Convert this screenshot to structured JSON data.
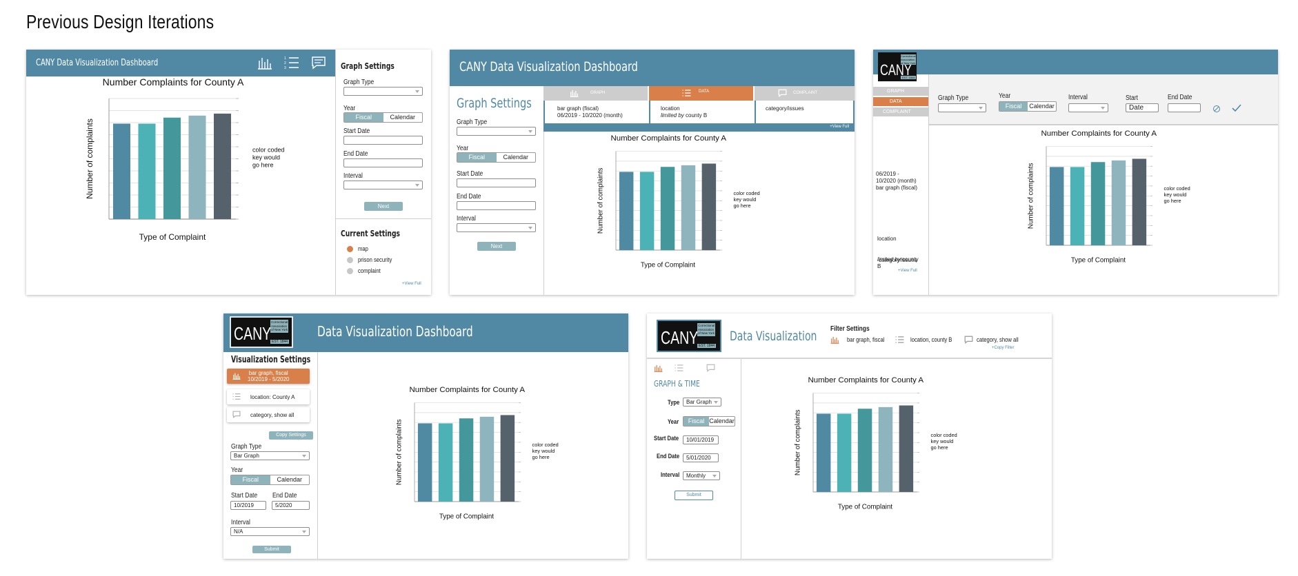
{
  "page_title": "Previous Design Iterations",
  "colors": {
    "header": "#5189a4",
    "accent": "#d9804a",
    "toggle": "#8fb3bb",
    "bars": [
      "#4f89a2",
      "#4cb2b5",
      "#44979b",
      "#8eb5bd",
      "#55626c"
    ]
  },
  "chart": {
    "title": "Number Complaints for County A",
    "xlabel": "Type of Complaint",
    "ylabel": "Number of complaints",
    "legend_note": "color coded\nkey would\ngo here"
  },
  "chart_data": {
    "type": "bar",
    "title": "Number Complaints for County A",
    "xlabel": "Type of Complaint",
    "ylabel": "Number of complaints",
    "values": [
      0.95,
      0.95,
      1.01,
      1.03,
      1.05
    ],
    "ylim": [
      0,
      1.2
    ],
    "grid": true,
    "legend": "color coded key would go here (right)"
  },
  "d1": {
    "title": "CANY Data Visualization Dashboard",
    "icons": [
      "bar-chart-icon",
      "list-icon",
      "comment-icon"
    ],
    "settings_title": "Graph Settings",
    "graph_type": "Graph Type",
    "year": "Year",
    "fiscal": "Fiscal",
    "calendar": "Calendar",
    "start_date": "Start Date",
    "end_date": "End Date",
    "interval": "Interval",
    "next": "Next",
    "current_title": "Current Settings",
    "current_items": [
      "map",
      "prison security",
      "complaint"
    ],
    "view_full": "+View Full"
  },
  "d2": {
    "title": "CANY Data Visualization Dashboard",
    "settings_title": "Graph Settings",
    "graph_type": "Graph Type",
    "year": "Year",
    "fiscal": "Fiscal",
    "calendar": "Calendar",
    "start_date": "Start Date",
    "end_date": "End Date",
    "interval": "Interval",
    "next": "Next",
    "tabs": [
      "GRAPH",
      "DATA",
      "COMPLAINT"
    ],
    "col1": "bar graph (fiscal)\n06/2019 - 10/2020 (month)",
    "col2a": "location",
    "col2b": "limited by",
    "col2c": " county B",
    "col3": "category/issues",
    "view_full": "+View Full"
  },
  "d3": {
    "logo_big": "CANY",
    "logo_org": "Correctional\nAssociation\nof New York",
    "logo_est": "EST. 1844",
    "tabs": [
      "GRAPH",
      "DATA",
      "COMPLAINT"
    ],
    "graph_type": "Graph Type",
    "year": "Year",
    "fiscal": "Fiscal",
    "calendar": "Calendar",
    "interval": "Interval",
    "start": "Start",
    "start_val": "Date",
    "end_date": "End Date",
    "side1": "06/2019 -\n10/2020 (month)\nbar graph (fiscal)",
    "side2a": "location",
    "side2b": "limited by",
    "side2c": " county\nB",
    "side3": "category/issues",
    "view_full": "+View Full"
  },
  "d4": {
    "logo_big": "CANY",
    "logo_org": "Correctional\nAssociation\nof New York",
    "logo_est": "EST. 1844",
    "title": "Data Visualization Dashboard",
    "settings_title": "Visualization Settings",
    "pill1": "bar graph, fiscal\n10/2019 - 5/2020",
    "pill2": "location: County A",
    "pill3": "category, show all",
    "copy": "Copy Settings",
    "graph_type": "Graph Type",
    "graph_type_val": "Bar Graph",
    "year": "Year",
    "fiscal": "Fiscal",
    "calendar": "Calendar",
    "start_date": "Start Date",
    "end_date": "End Date",
    "start_val": "10/2019",
    "end_val": "5/2020",
    "interval": "Interval",
    "interval_val": "N/A",
    "submit": "Submit"
  },
  "d5": {
    "logo_big": "CANY",
    "logo_org": "Correctional\nAssociation\nof New York",
    "logo_est": "EST. 1844",
    "title": "Data Visualization",
    "filter_title": "Filter Settings",
    "f1": "bar graph, fiscal",
    "f2": "location, county B",
    "f3": "category, show all",
    "copy_filter": "+Copy Filter",
    "section": "GRAPH & TIME",
    "type": "Type",
    "type_val": "Bar Graph",
    "year": "Year",
    "fiscal": "Fiscal",
    "calendar": "Calendar",
    "start_date": "Start Date",
    "start_val": "10/01/2019",
    "end_date": "End Date",
    "end_val": "5/01/2020",
    "interval": "Interval",
    "interval_val": "Monthly",
    "submit": "Submit"
  }
}
